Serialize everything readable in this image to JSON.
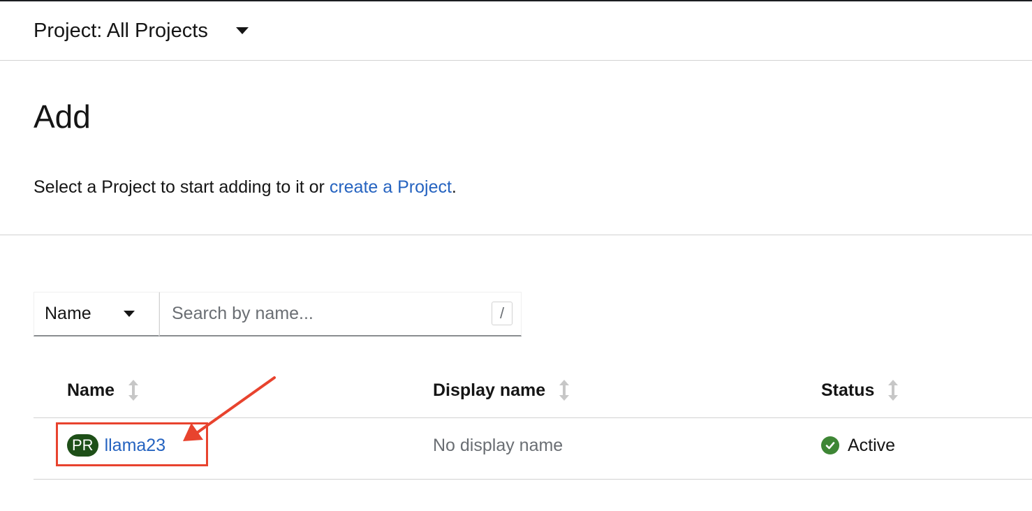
{
  "project_selector": {
    "label": "Project: All Projects"
  },
  "page": {
    "title": "Add",
    "intro_text": "Select a Project to start adding to it or ",
    "intro_link": "create a Project",
    "intro_suffix": "."
  },
  "filter": {
    "type_label": "Name",
    "search_placeholder": "Search by name...",
    "shortcut_hint": "/"
  },
  "table": {
    "columns": [
      {
        "label": "Name"
      },
      {
        "label": "Display name"
      },
      {
        "label": "Status"
      }
    ],
    "rows": [
      {
        "badge": "PR",
        "name": "llama23",
        "display_name": "No display name",
        "status": "Active"
      }
    ]
  },
  "colors": {
    "link": "#2563c0",
    "badge_bg": "#1e4f18",
    "status_ok": "#3e8635",
    "annotation": "#e8432e"
  },
  "icons": {
    "dropdown": "caret-down-icon",
    "sort": "sort-icon",
    "status": "check-circle-icon"
  }
}
